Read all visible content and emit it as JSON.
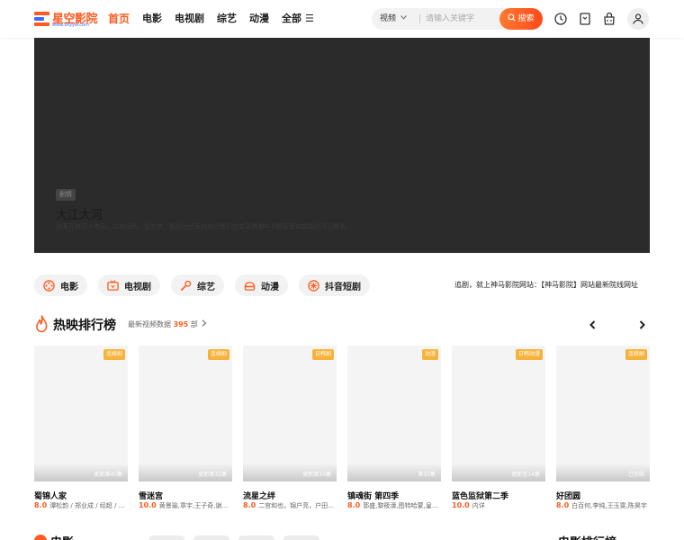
{
  "header": {
    "logo_text": "星空影院",
    "logo_sub": "www.xkyyw.com",
    "nav": [
      {
        "label": "首页",
        "active": true
      },
      {
        "label": "电影",
        "active": false
      },
      {
        "label": "电视剧",
        "active": false
      },
      {
        "label": "综艺",
        "active": false
      },
      {
        "label": "动漫",
        "active": false
      },
      {
        "label": "全部",
        "active": false
      }
    ],
    "search": {
      "type_label": "视频",
      "placeholder": "请输入关键字",
      "button_label": "搜索"
    },
    "icons": [
      "clock-icon",
      "bookmark-icon",
      "store-icon",
      "user-icon"
    ]
  },
  "banner": {
    "tag": "剧情",
    "title": "大江大河",
    "desc": "改革开放四十年间，以宋运辉、雷东宝、杨巡为代表的先行者们在变革浪潮中不断探索和突围的浮沉故事。"
  },
  "categories": [
    {
      "label": "电影",
      "icon": "film-reel-icon"
    },
    {
      "label": "电视剧",
      "icon": "tv-icon"
    },
    {
      "label": "综艺",
      "icon": "microphone-icon"
    },
    {
      "label": "动漫",
      "icon": "anime-icon"
    },
    {
      "label": "抖音短剧",
      "icon": "short-drama-icon"
    }
  ],
  "notice": "追剧，就上神马影院网站：【神马影院】网站最新院线网址",
  "hot": {
    "title": "热映排行榜",
    "count_prefix": "最新视频数据",
    "count": "395",
    "count_suffix": "部"
  },
  "cards": [
    {
      "title": "蜀锦人家",
      "badge": "连续剧",
      "episode": "更新第40集",
      "score": "8.0",
      "meta": "谭松韵 / 郑业成 / 经超 / 何杜娟"
    },
    {
      "title": "雪迷宫",
      "badge": "连续剧",
      "episode": "更新第32集",
      "score": "10.0",
      "meta": "黄景瑜,章宇,王子奇,谢可寅"
    },
    {
      "title": "流星之绊",
      "badge": "日韩剧",
      "episode": "更新第10集",
      "score": "8.0",
      "meta": "二宫和也，锦户亮，户田惠梨香"
    },
    {
      "title": "镇魂街 第四季",
      "badge": "动漫",
      "episode": "第10集",
      "score": "8.0",
      "meta": "郭盛,黎筱濠,图特哈蒙,皇贞季"
    },
    {
      "title": "蓝色监狱第二季",
      "badge": "日韩动漫",
      "episode": "更新至14集",
      "score": "10.0",
      "meta": "内详"
    },
    {
      "title": "好团圆",
      "badge": "连续剧",
      "episode": "已完结",
      "score": "8.0",
      "meta": "白百何,李纯,王玉雯,陈昊宇"
    }
  ],
  "next_section": {
    "title": "电影",
    "title2": "电影排行榜"
  },
  "colors": {
    "accent": "#ff5a1f",
    "badge": "#f6b23a",
    "banner_bg": "#2b2b2b",
    "poster_bg": "#f4f4f4",
    "pill_bg": "#f2f2f2"
  }
}
